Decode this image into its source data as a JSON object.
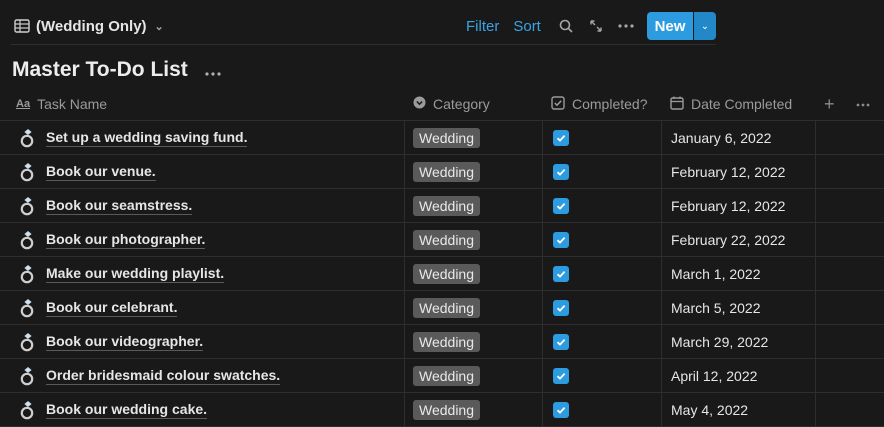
{
  "view": {
    "label": "(Wedding Only)",
    "icon": "table-icon"
  },
  "toolbar": {
    "filter_label": "Filter",
    "sort_label": "Sort",
    "search_icon": "search-icon",
    "expand_icon": "expand-icon",
    "more_icon": "more-icon",
    "new_label": "New"
  },
  "page": {
    "title": "Master To-Do List"
  },
  "columns": {
    "task": "Task Name",
    "category": "Category",
    "completed": "Completed?",
    "date": "Date Completed"
  },
  "colors": {
    "accent": "#2d9be0",
    "link": "#3ba3e3",
    "tag_bg": "#5a5a5a",
    "background": "#191919"
  },
  "rows": [
    {
      "task": "Set up a wedding saving fund.",
      "category": "Wedding",
      "completed": true,
      "date": "January 6, 2022"
    },
    {
      "task": "Book our venue.",
      "category": "Wedding",
      "completed": true,
      "date": "February 12, 2022"
    },
    {
      "task": "Book our seamstress.",
      "category": "Wedding",
      "completed": true,
      "date": "February 12, 2022"
    },
    {
      "task": "Book our photographer.",
      "category": "Wedding",
      "completed": true,
      "date": "February 22, 2022"
    },
    {
      "task": "Make our wedding playlist.",
      "category": "Wedding",
      "completed": true,
      "date": "March 1, 2022"
    },
    {
      "task": "Book our celebrant.",
      "category": "Wedding",
      "completed": true,
      "date": "March 5, 2022"
    },
    {
      "task": "Book our videographer.",
      "category": "Wedding",
      "completed": true,
      "date": "March 29, 2022"
    },
    {
      "task": "Order bridesmaid colour swatches.",
      "category": "Wedding",
      "completed": true,
      "date": "April 12, 2022"
    },
    {
      "task": "Book our wedding cake.",
      "category": "Wedding",
      "completed": true,
      "date": "May 4, 2022"
    }
  ]
}
